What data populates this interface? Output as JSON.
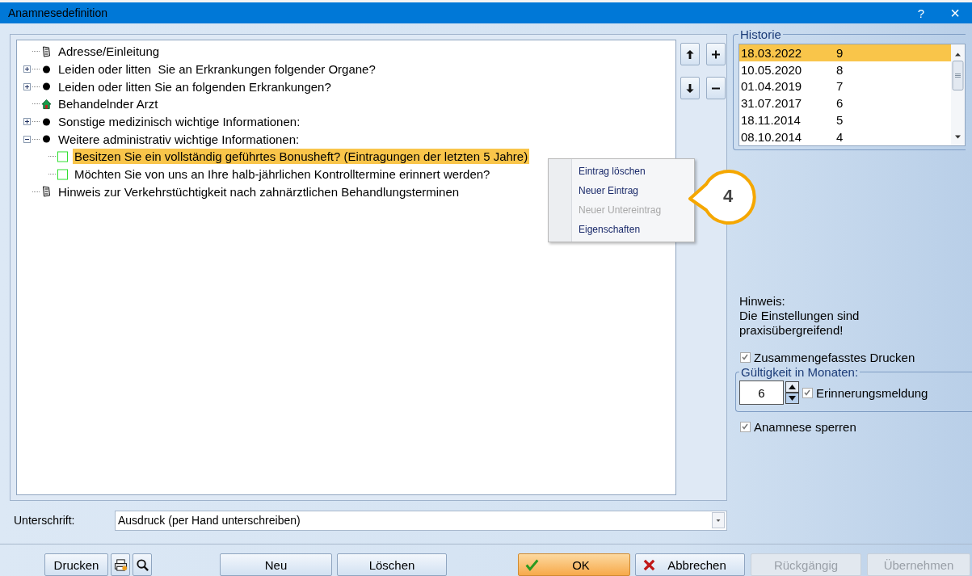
{
  "window": {
    "title": "Anamnesedefinition",
    "help": "?",
    "close": "×"
  },
  "tree": {
    "items": [
      {
        "kind": "document",
        "label": "Adresse/Einleitung",
        "selected": false
      },
      {
        "kind": "bullet",
        "label": "Leiden oder litten  Sie an Erkrankungen folgender Organe?",
        "expanded": false,
        "selected": false
      },
      {
        "kind": "bullet",
        "label": "Leiden oder litten Sie an folgenden Erkrankungen?",
        "expanded": false,
        "selected": false
      },
      {
        "kind": "house",
        "label": "Behandelnder Arzt",
        "selected": false
      },
      {
        "kind": "bullet",
        "label": "Sonstige medizinisch wichtige Informationen:",
        "expanded": false,
        "selected": false
      },
      {
        "kind": "bullet",
        "label": "Weitere administrativ wichtige Informationen:",
        "expanded": true,
        "selected": false,
        "children": [
          {
            "kind": "checkbox",
            "label": "Besitzen Sie ein vollständig geführtes Bonusheft? (Eintragungen der letzten 5 Jahre)",
            "checked": false,
            "selected": true
          },
          {
            "kind": "checkbox",
            "label": "Möchten Sie von uns an Ihre halb-jährlichen Kontrolltermine erinnert werden?",
            "checked": false,
            "selected": false
          }
        ]
      },
      {
        "kind": "document",
        "label": "Hinweis zur Verkehrstüchtigkeit nach zahnärztlichen Behandlungsterminen",
        "selected": false
      }
    ]
  },
  "context_menu": {
    "items": [
      {
        "label": "Eintrag löschen",
        "disabled": false
      },
      {
        "label": "Neuer Eintrag",
        "disabled": false
      },
      {
        "label": "Neuer Untereintrag",
        "disabled": true
      },
      {
        "label": "Eigenschaften",
        "disabled": false
      }
    ]
  },
  "callout": {
    "label": "4"
  },
  "history": {
    "title": "Historie",
    "rows": [
      {
        "date": "18.03.2022",
        "number": "9",
        "selected": true
      },
      {
        "date": "10.05.2020",
        "number": "8",
        "selected": false
      },
      {
        "date": "01.04.2019",
        "number": "7",
        "selected": false
      },
      {
        "date": "31.07.2017",
        "number": "6",
        "selected": false
      },
      {
        "date": "18.11.2014",
        "number": "5",
        "selected": false
      },
      {
        "date": "08.10.2014",
        "number": "4",
        "selected": false
      }
    ]
  },
  "note": {
    "heading": "Hinweis:",
    "text": "Die Einstellungen sind praxisübergreifend!"
  },
  "combined_print": {
    "label": "Zusammengefasstes Drucken",
    "checked": true
  },
  "validity": {
    "title": "Gültigkeit in Monaten:",
    "value": "6",
    "reminder": {
      "label": "Erinnerungsmeldung",
      "checked": true
    }
  },
  "lock": {
    "label": "Anamnese sperren",
    "checked": true
  },
  "signature": {
    "label": "Unterschrift:",
    "value": "Ausdruck (per Hand unterschreiben)"
  },
  "buttons": [
    {
      "kind": "text",
      "label": "Drucken",
      "disabled": false
    },
    {
      "kind": "printer",
      "disabled": false
    },
    {
      "kind": "search",
      "disabled": false
    },
    {
      "kind": "text",
      "label": "Neu",
      "disabled": false
    },
    {
      "kind": "text",
      "label": "Löschen",
      "disabled": false
    },
    {
      "kind": "ok",
      "label": "OK",
      "disabled": false
    },
    {
      "kind": "cancel",
      "label": "Abbrechen",
      "disabled": false
    },
    {
      "kind": "text",
      "label": "Rückgängig",
      "disabled": true
    },
    {
      "kind": "text",
      "label": "Übernehmen",
      "disabled": true
    }
  ]
}
